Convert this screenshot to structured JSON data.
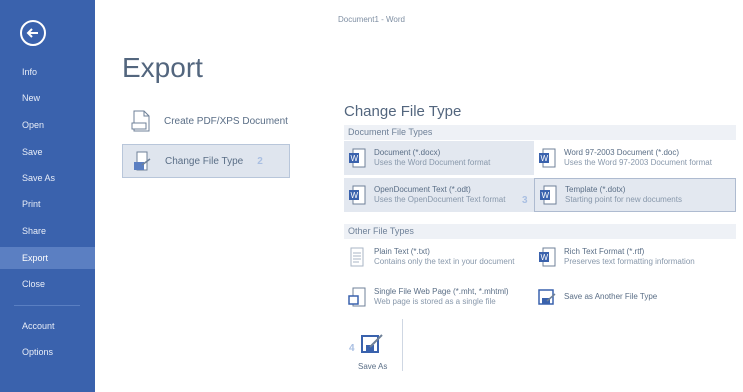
{
  "window": {
    "title": "Document1 - Word"
  },
  "sidebar": {
    "items": [
      {
        "label": "Info"
      },
      {
        "label": "New"
      },
      {
        "label": "Open"
      },
      {
        "label": "Save"
      },
      {
        "label": "Save As"
      },
      {
        "label": "Print"
      },
      {
        "label": "Share"
      },
      {
        "label": "Export"
      },
      {
        "label": "Close"
      },
      {
        "label": "Account"
      },
      {
        "label": "Options"
      }
    ]
  },
  "main": {
    "title": "Export",
    "left_options": [
      {
        "label": "Create PDF/XPS Document"
      },
      {
        "label": "Change File Type",
        "step": "2"
      }
    ],
    "section_title": "Change File Type",
    "groups": [
      {
        "title": "Document File Types"
      },
      {
        "title": "Other File Types"
      }
    ],
    "document_types": [
      {
        "name": "Document (*.docx)",
        "desc": "Uses the Word Document format"
      },
      {
        "name": "Word 97-2003 Document (*.doc)",
        "desc": "Uses the Word 97-2003 Document format"
      },
      {
        "name": "OpenDocument Text (*.odt)",
        "desc": "Uses the OpenDocument Text format"
      },
      {
        "name": "Template (*.dotx)",
        "desc": "Starting point for new documents",
        "step": "3"
      }
    ],
    "other_types": [
      {
        "name": "Plain Text (*.txt)",
        "desc": "Contains only the text in your document"
      },
      {
        "name": "Rich Text Format (*.rtf)",
        "desc": "Preserves text formatting information"
      },
      {
        "name": "Single File Web Page (*.mht, *.mhtml)",
        "desc": "Web page is stored as a single file"
      },
      {
        "name": "Save as Another File Type",
        "desc": ""
      }
    ],
    "save_as": {
      "label": "Save As",
      "step": "4"
    }
  }
}
